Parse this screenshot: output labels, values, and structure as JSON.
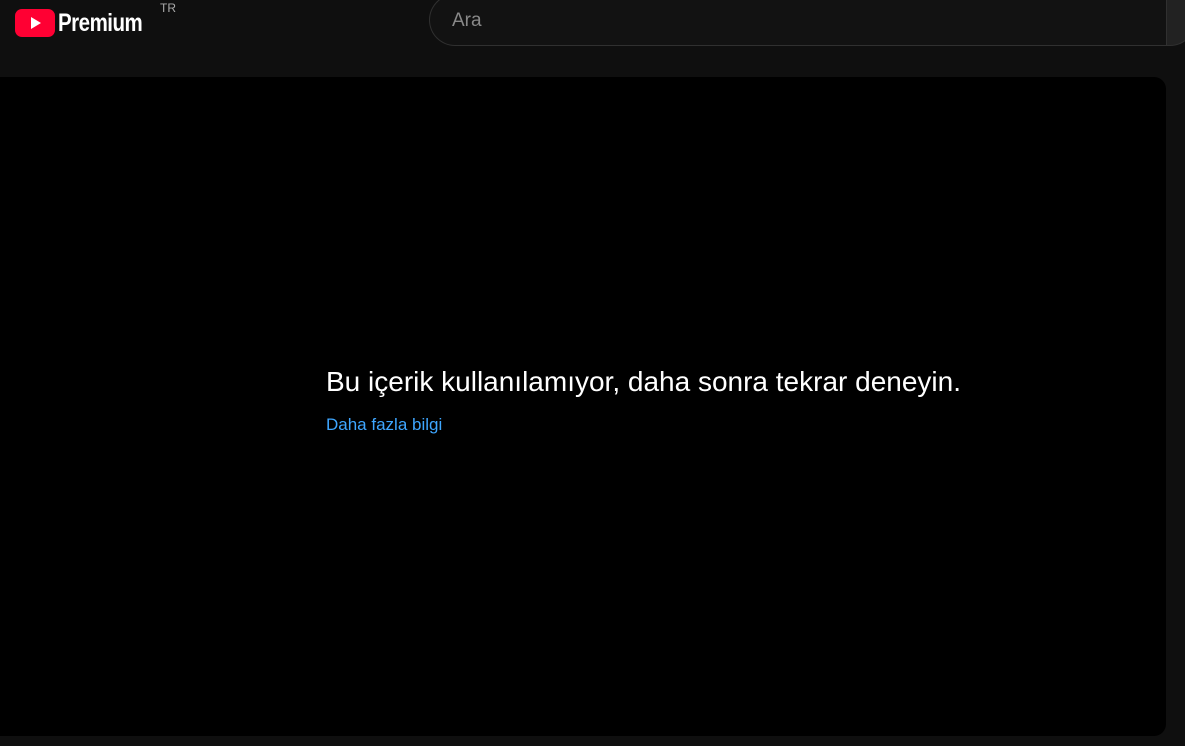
{
  "header": {
    "logo_text": "Premium",
    "country_code": "TR",
    "logo_icon": "youtube-play-icon",
    "brand_color": "#ff0000"
  },
  "search": {
    "placeholder": "Ara",
    "value": ""
  },
  "player": {
    "error_message": "Bu içerik kullanılamıyor, daha sonra tekrar deneyin.",
    "learn_more_label": "Daha fazla bilgi",
    "link_color": "#3ea6ff"
  }
}
